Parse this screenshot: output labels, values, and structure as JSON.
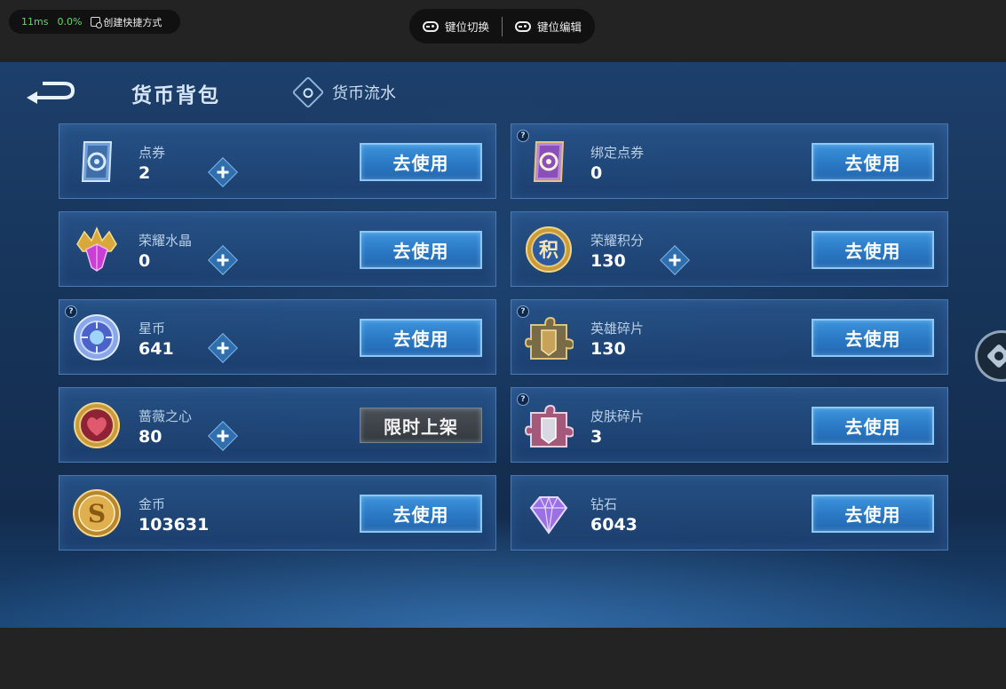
{
  "overlay": {
    "latency": "11ms",
    "loss": "0.0%",
    "shortcut_label": "创建快捷方式",
    "key_switch_label": "键位切换",
    "key_edit_label": "键位编辑"
  },
  "header": {
    "title": "货币背包",
    "flow_tab": "货币流水"
  },
  "currencies": [
    {
      "name": "点券",
      "amount": "2",
      "has_plus": true,
      "has_help": false,
      "button": "去使用",
      "icon": "ticket-icon"
    },
    {
      "name": "绑定点券",
      "amount": "0",
      "has_plus": false,
      "has_help": true,
      "button": "去使用",
      "icon": "bound-ticket-icon"
    },
    {
      "name": "荣耀水晶",
      "amount": "0",
      "has_plus": true,
      "has_help": false,
      "button": "去使用",
      "icon": "glory-crystal-icon"
    },
    {
      "name": "荣耀积分",
      "amount": "130",
      "has_plus": true,
      "has_help": false,
      "button": "去使用",
      "icon": "glory-points-icon"
    },
    {
      "name": "星币",
      "amount": "641",
      "has_plus": true,
      "has_help": true,
      "button": "去使用",
      "icon": "star-coin-icon"
    },
    {
      "name": "英雄碎片",
      "amount": "130",
      "has_plus": false,
      "has_help": true,
      "button": "去使用",
      "icon": "hero-fragment-icon"
    },
    {
      "name": "蔷薇之心",
      "amount": "80",
      "has_plus": true,
      "has_help": false,
      "button": "限时上架",
      "icon": "rose-heart-icon"
    },
    {
      "name": "皮肤碎片",
      "amount": "3",
      "has_plus": false,
      "has_help": true,
      "button": "去使用",
      "icon": "skin-fragment-icon"
    },
    {
      "name": "金币",
      "amount": "103631",
      "has_plus": false,
      "has_help": false,
      "button": "去使用",
      "icon": "gold-coin-icon"
    },
    {
      "name": "钻石",
      "amount": "6043",
      "has_plus": false,
      "has_help": false,
      "button": "去使用",
      "icon": "diamond-icon"
    }
  ],
  "help_mark": "?"
}
